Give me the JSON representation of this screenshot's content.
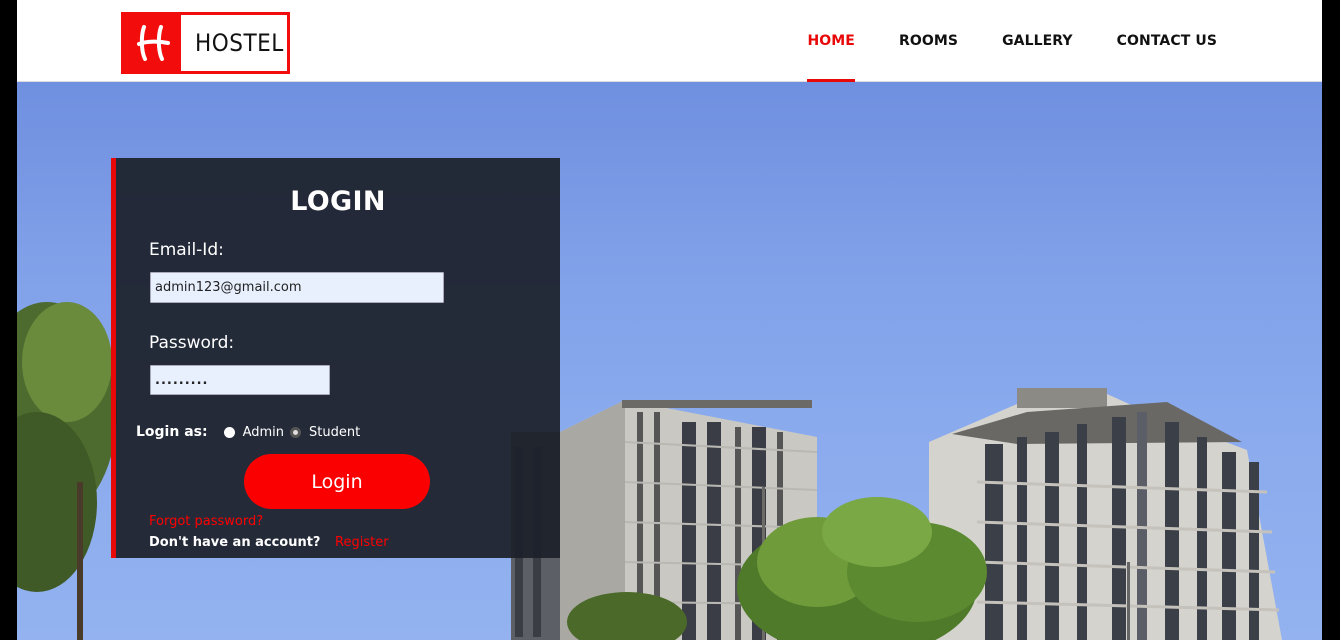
{
  "brand": {
    "logo_letter": "H",
    "name": "HOSTEL"
  },
  "nav": {
    "items": [
      {
        "label": "HOME",
        "active": true
      },
      {
        "label": "ROOMS",
        "active": false
      },
      {
        "label": "GALLERY",
        "active": false
      },
      {
        "label": "CONTACT US",
        "active": false
      }
    ]
  },
  "login": {
    "title": "LOGIN",
    "email_label": "Email-Id:",
    "email_value": "admin123@gmail.com",
    "password_label": "Password:",
    "password_value": ".........",
    "role_label": "Login as:",
    "role_options": [
      "Admin",
      "Student"
    ],
    "button_label": "Login",
    "forgot_link": "Forgot password?",
    "no_account_text": "Don't have an account?",
    "register_link": "Register"
  },
  "colors": {
    "accent": "#e80808",
    "panel": "#1c202a",
    "sky": "#7f9fe8"
  }
}
